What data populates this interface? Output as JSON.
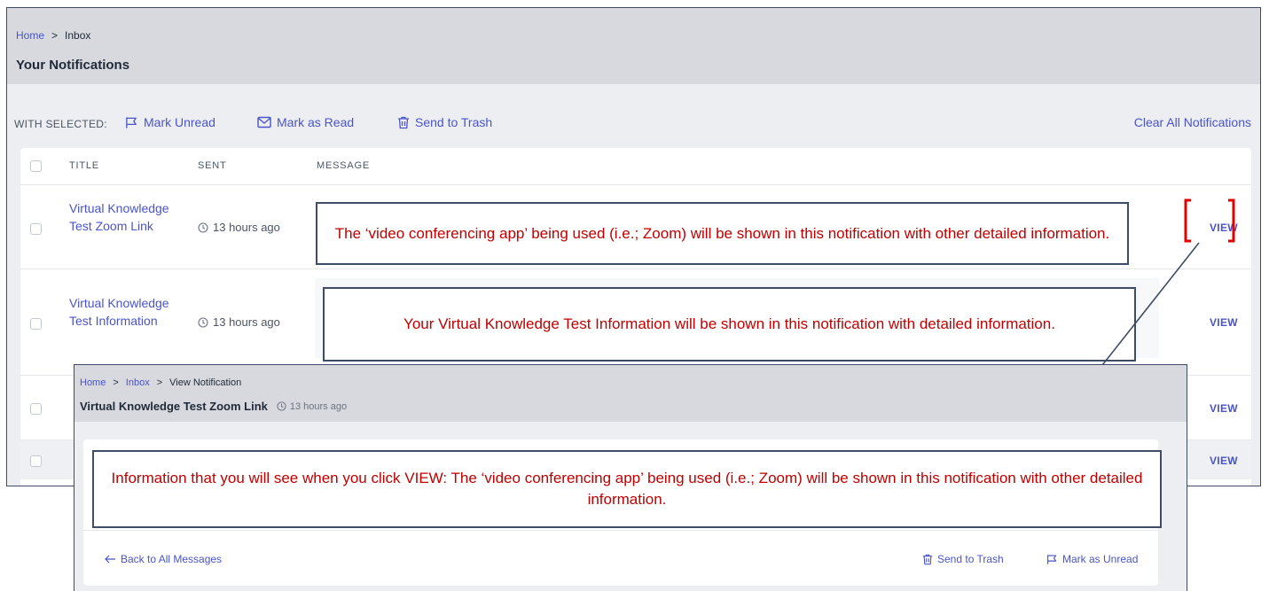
{
  "main": {
    "breadcrumb": {
      "home": "Home",
      "separator": ">",
      "current": "Inbox"
    },
    "title": "Your Notifications",
    "toolbar": {
      "with_selected": "WITH SELECTED:",
      "mark_unread": "Mark Unread",
      "mark_read": "Mark as Read",
      "send_trash": "Send to Trash",
      "clear_all": "Clear All Notifications"
    },
    "columns": {
      "title": "TITLE",
      "sent": "SENT",
      "message": "MESSAGE"
    },
    "rows": [
      {
        "title": "Virtual Knowledge Test Zoom Link",
        "sent": "13 hours ago",
        "view": "VIEW"
      },
      {
        "title": "Virtual Knowledge Test Information",
        "sent": "13 hours ago",
        "view": "VIEW"
      },
      {
        "title": "",
        "sent": "",
        "view": "VIEW"
      },
      {
        "title": "",
        "sent": "",
        "view": "VIEW"
      }
    ]
  },
  "callouts": {
    "zoom": "The ‘video conferencing app’ being used (i.e.; Zoom) will be shown in this notification with other detailed information.",
    "info": "Your Virtual Knowledge Test Information will be shown in this notification with detailed information.",
    "view": "Information that you will see when you click VIEW:  The ‘video conferencing app’ being used (i.e.; Zoom) will be shown in this notification with other detailed information."
  },
  "overlay": {
    "breadcrumb": {
      "home": "Home",
      "inbox": "Inbox",
      "current": "View Notification",
      "separator": ">"
    },
    "title": "Virtual Knowledge Test Zoom Link",
    "sent": "13 hours ago",
    "back": "Back to All Messages",
    "send_trash": "Send to Trash",
    "mark_unread": "Mark as Unread"
  },
  "colors": {
    "accent": "#4a54c8",
    "callout_text": "#c00000",
    "callout_border": "#3f4c66",
    "highlight_bracket": "#e00000"
  },
  "icons": {
    "flag": "flag-icon",
    "envelope": "envelope-icon",
    "trash": "trash-icon",
    "clock": "clock-icon",
    "arrow_left": "arrow-left-icon"
  }
}
